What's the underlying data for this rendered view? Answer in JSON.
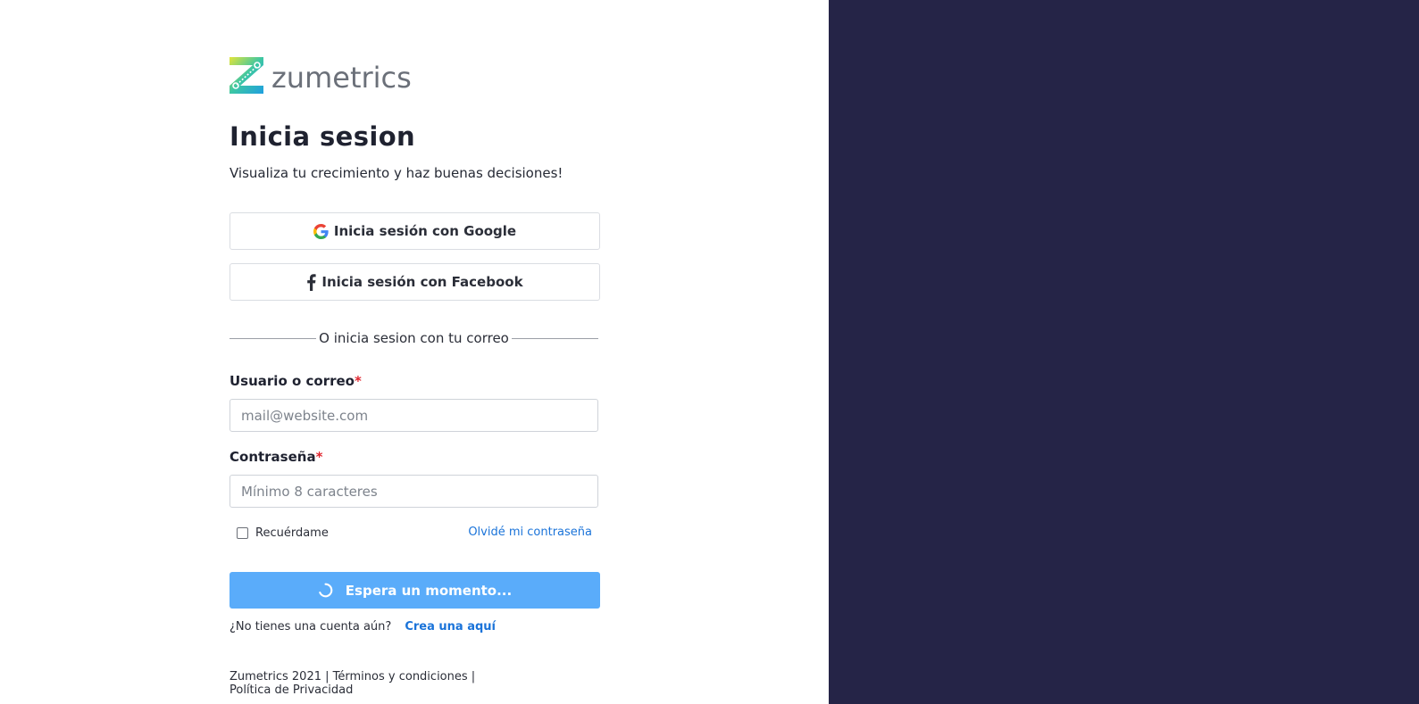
{
  "brand": {
    "name": "zumetrics",
    "logo_icon": "zumetrics-z-icon"
  },
  "header": {
    "title": "Inicia sesion",
    "subtitle": "Visualiza tu crecimiento y haz buenas decisiones!"
  },
  "social": {
    "google_label": "Inicia sesión con Google",
    "facebook_label": "Inicia sesión con Facebook"
  },
  "divider_text": "O inicia sesion con tu correo",
  "form": {
    "user_label": "Usuario o correo",
    "user_placeholder": "mail@website.com",
    "password_label": "Contraseña",
    "password_placeholder": "Mínimo 8 caracteres",
    "required_mark": "*",
    "remember_label": "Recuérdame",
    "remember_checked": false,
    "forgot_label": "Olvidé mi contraseña",
    "submit_label": "Espera un momento..."
  },
  "signup": {
    "prompt": "¿No tienes una cuenta aún?",
    "link": "Crea una aquí"
  },
  "footer": {
    "copyright": "Zumetrics 2021",
    "separator": "|",
    "terms": "Términos y condiciones",
    "privacy": "Política de Privacidad"
  },
  "colors": {
    "panel_bg": "#252447",
    "primary": "#5aacfa",
    "link": "#1a73d9",
    "required": "#e0262f"
  }
}
